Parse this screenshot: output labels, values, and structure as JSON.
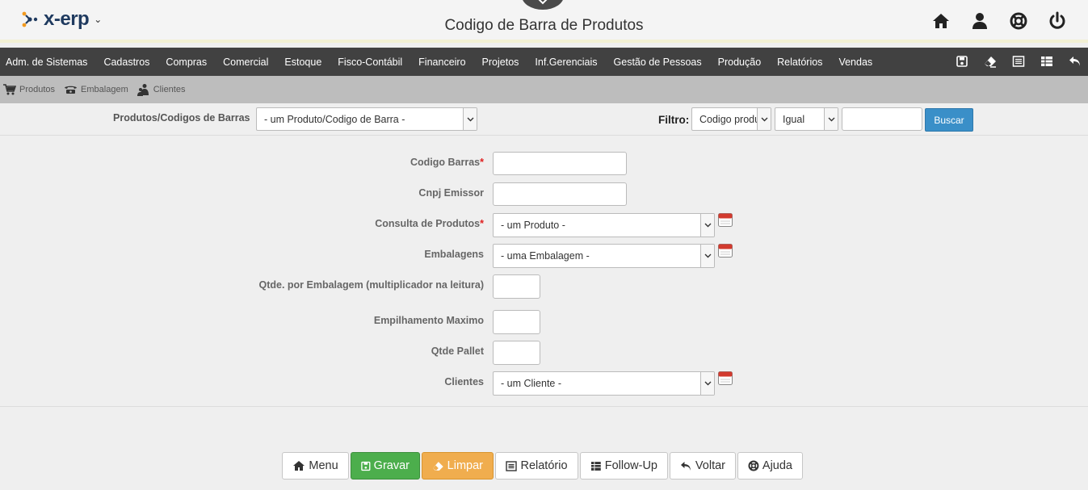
{
  "header": {
    "logo_text": "x-erp",
    "page_title": "Codigo de Barra de Produtos",
    "icons": [
      "home-icon",
      "user-icon",
      "lifebuoy-icon",
      "power-icon"
    ]
  },
  "menubar": {
    "items": [
      "Adm. de Sistemas",
      "Cadastros",
      "Compras",
      "Comercial",
      "Estoque",
      "Fisco-Contábil",
      "Financeiro",
      "Projetos",
      "Inf.Gerenciais",
      "Gestão de Pessoas",
      "Produção",
      "Relatórios",
      "Vendas"
    ],
    "tools": [
      "save-icon",
      "eraser-icon",
      "list-icon",
      "table-icon",
      "undo-icon"
    ]
  },
  "subbar": {
    "items": [
      {
        "label": "Produtos",
        "icon": "cart-icon"
      },
      {
        "label": "Embalagem",
        "icon": "phone-icon"
      },
      {
        "label": "Clientes",
        "icon": "people-icon"
      }
    ]
  },
  "filter": {
    "record_label": "Produtos/Codigos de Barras",
    "record_select": "- um Produto/Codigo de Barra -",
    "filtro_label": "Filtro:",
    "field_select": "Codigo produto",
    "operator_select": "Igual",
    "value": "",
    "search_button": "Buscar"
  },
  "form": {
    "codigo_barras": {
      "label": "Codigo Barras",
      "required": "*",
      "value": ""
    },
    "cnpj_emissor": {
      "label": "Cnpj Emissor",
      "value": ""
    },
    "consulta_produtos": {
      "label": "Consulta de Produtos",
      "required": "*",
      "selected": "- um Produto -"
    },
    "embalagens": {
      "label": "Embalagens",
      "selected": "- uma Embalagem -"
    },
    "qtde_embalagem": {
      "label": "Qtde. por Embalagem (multiplicador na leitura)",
      "value": ""
    },
    "empilhamento": {
      "label": "Empilhamento Maximo",
      "value": ""
    },
    "qtde_pallet": {
      "label": "Qtde Pallet",
      "value": ""
    },
    "clientes": {
      "label": "Clientes",
      "selected": "- um Cliente -"
    }
  },
  "footer": {
    "menu": "Menu",
    "gravar": "Gravar",
    "limpar": "Limpar",
    "relatorio": "Relatório",
    "followup": "Follow-Up",
    "voltar": "Voltar",
    "ajuda": "Ajuda"
  },
  "colors": {
    "menubar": "#414141",
    "subbar": "#bdbdbd",
    "primary": "#3a8fc8",
    "success": "#4cae4c",
    "warning": "#f0ad4e",
    "required": "#e02020"
  }
}
